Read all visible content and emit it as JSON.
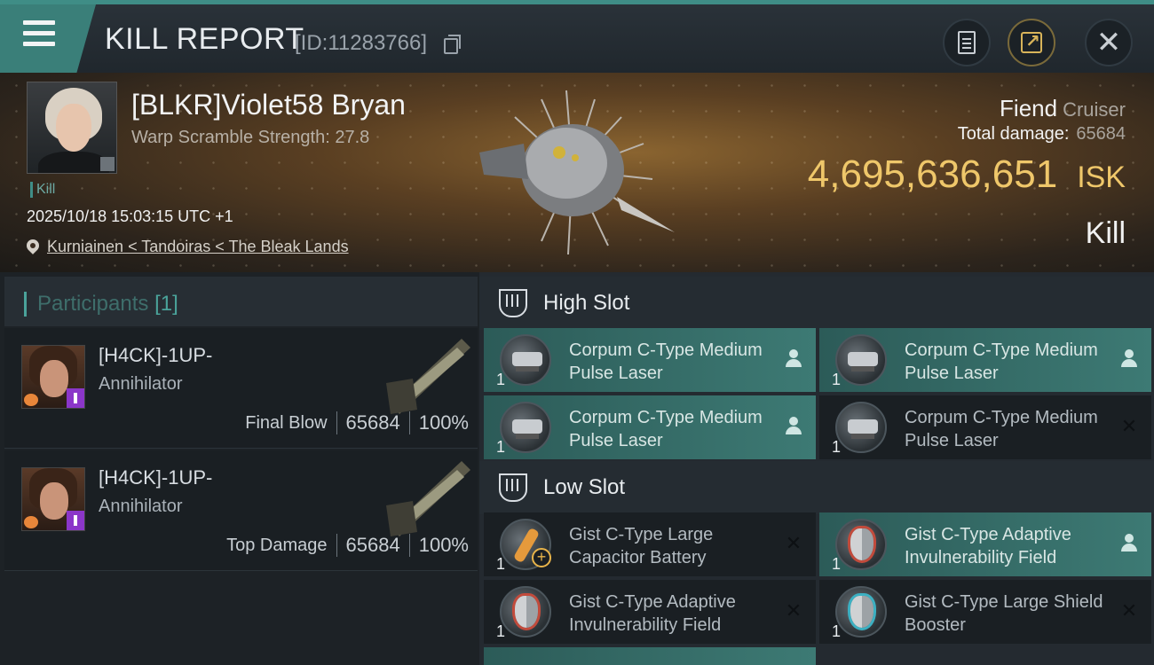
{
  "header": {
    "title": "KILL REPORT",
    "report_id": "[ID:11283766]"
  },
  "victim": {
    "name": "[BLKR]Violet58 Bryan",
    "warp_scramble": "Warp Scramble Strength: 27.8",
    "tag": "Kill",
    "datetime": "2025/10/18 15:03:15 UTC +1",
    "location": "Kurniainen < Tandoiras < The Bleak Lands",
    "ship_name": "Fiend",
    "ship_class": "Cruiser",
    "total_damage_label": "Total damage:",
    "total_damage": "65684",
    "isk_value": "4,695,636,651",
    "isk_unit": "ISK",
    "result": "Kill"
  },
  "participants": {
    "title": "Participants",
    "count": "[1]",
    "rows": [
      {
        "name": "[H4CK]-1UP-",
        "ship": "Annihilator",
        "label": "Final Blow",
        "damage": "65684",
        "percent": "100%"
      },
      {
        "name": "[H4CK]-1UP-",
        "ship": "Annihilator",
        "label": "Top Damage",
        "damage": "65684",
        "percent": "100%"
      }
    ]
  },
  "fitting": {
    "high_slot": {
      "title": "High Slot",
      "modules": [
        {
          "qty": "1",
          "name": "Corpum C-Type Medium Pulse Laser",
          "status": "person"
        },
        {
          "qty": "1",
          "name": "Corpum C-Type Medium Pulse Laser",
          "status": "person"
        },
        {
          "qty": "1",
          "name": "Corpum C-Type Medium Pulse Laser",
          "status": "person"
        },
        {
          "qty": "1",
          "name": "Corpum C-Type Medium Pulse Laser",
          "status": "destroyed"
        }
      ]
    },
    "low_slot": {
      "title": "Low Slot",
      "modules": [
        {
          "qty": "1",
          "name": "Gist C-Type Large Capacitor Battery",
          "status": "destroyed"
        },
        {
          "qty": "1",
          "name": "Gist C-Type Adaptive Invulnerability Field",
          "status": "person"
        },
        {
          "qty": "1",
          "name": "Gist C-Type Adaptive Invulnerability Field",
          "status": "destroyed"
        },
        {
          "qty": "1",
          "name": "Gist C-Type Large Shield Booster",
          "status": "destroyed"
        }
      ]
    },
    "icons": {
      "slot": "slot-icon",
      "person": "person-icon",
      "destroyed": "x-icon"
    }
  },
  "colors": {
    "accent": "#3f8d86",
    "isk": "#efc76a",
    "module_dropped": "#3d7a74",
    "module_destroyed": "#1a1f23"
  }
}
